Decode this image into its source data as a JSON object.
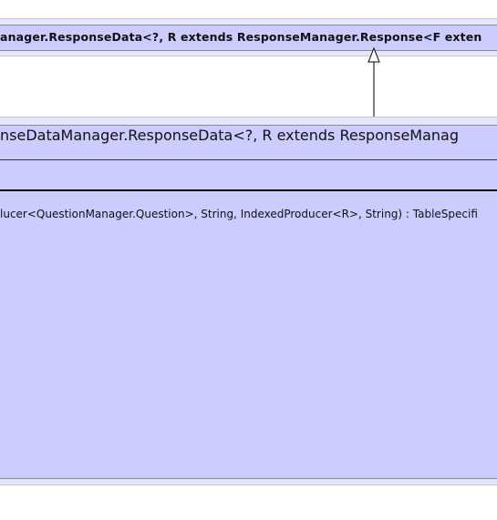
{
  "diagram": {
    "superclass": {
      "title": "anager.ResponseData<?, R extends ResponseManager.Response<F exten"
    },
    "class": {
      "title": "nseDataManager.ResponseData<?, R extends ResponseManag",
      "attributes": [],
      "methods": [
        "lucer<QuestionManager.Question>, String, IndexedProducer<R>, String) : TableSpecifi"
      ]
    },
    "relation": {
      "type": "generalization"
    },
    "colors": {
      "box_fill": "#ccccff",
      "box_halo": "#e6e6fa",
      "border": "#8a8a9a",
      "line": "#000000"
    }
  }
}
